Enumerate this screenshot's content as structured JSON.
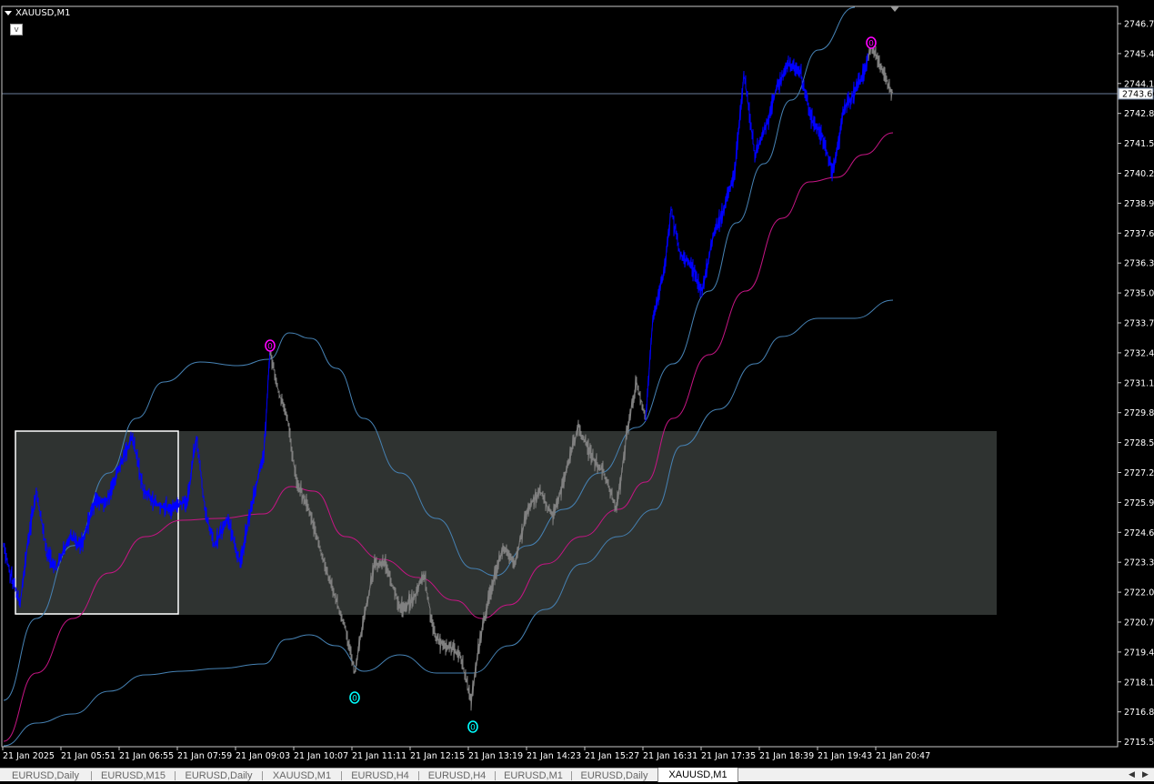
{
  "chart": {
    "symbol": "XAUUSD,M1",
    "mini_button": "v",
    "current_price": "2743.66",
    "price_labels": [
      "2746.70",
      "2745.40",
      "2744.10",
      "2742.80",
      "2741.50",
      "2740.20",
      "2738.90",
      "2737.60",
      "2736.30",
      "2735.00",
      "2733.70",
      "2732.40",
      "2731.10",
      "2729.80",
      "2728.50",
      "2727.20",
      "2725.90",
      "2724.60",
      "2723.30",
      "2722.00",
      "2720.70",
      "2719.40",
      "2718.10",
      "2716.80",
      "2715.50"
    ],
    "time_labels": [
      "21 Jan 2025",
      "21 Jan 05:51",
      "21 Jan 06:55",
      "21 Jan 07:59",
      "21 Jan 09:03",
      "21 Jan 10:07",
      "21 Jan 11:11",
      "21 Jan 12:15",
      "21 Jan 13:19",
      "21 Jan 14:23",
      "21 Jan 15:27",
      "21 Jan 16:31",
      "21 Jan 17:35",
      "21 Jan 18:39",
      "21 Jan 19:43",
      "21 Jan 20:47"
    ],
    "markers": [
      {
        "label": "0",
        "kind": "high",
        "color": "#ff00ff"
      },
      {
        "label": "0",
        "kind": "low",
        "color": "#00ffff"
      },
      {
        "label": "0",
        "kind": "low",
        "color": "#00ffff"
      },
      {
        "label": "0",
        "kind": "high",
        "color": "#ff00ff"
      }
    ],
    "colors": {
      "up_trend": "#0000ff",
      "down_trend": "#808080",
      "band": "#4682b4",
      "middle": "#c71585",
      "zone": "#2f3331",
      "box": "#ffffff"
    }
  },
  "tabs": [
    {
      "label": "EURUSD,Daily",
      "active": false
    },
    {
      "label": "EURUSD,M15",
      "active": false
    },
    {
      "label": "EURUSD,Daily",
      "active": false
    },
    {
      "label": "XAUUSD,M1",
      "active": false
    },
    {
      "label": "EURUSD,H4",
      "active": false
    },
    {
      "label": "EURUSD,H4",
      "active": false
    },
    {
      "label": "EURUSD,M1",
      "active": false
    },
    {
      "label": "EURUSD,Daily",
      "active": false
    },
    {
      "label": "XAUUSD,M1",
      "active": true
    }
  ],
  "tab_scroll": {
    "left": "◀",
    "right": "▶"
  }
}
